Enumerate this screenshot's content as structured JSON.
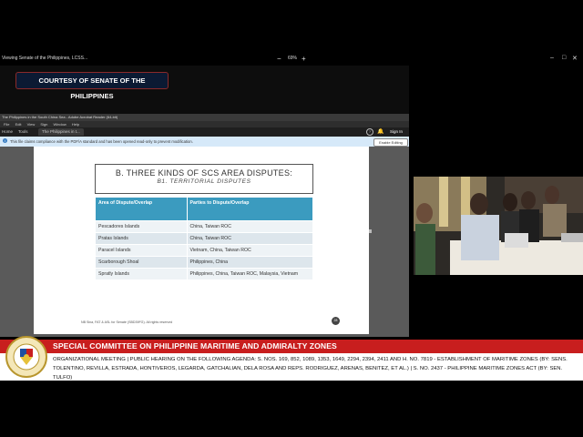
{
  "share_bar": {
    "title": "Viewing Senate of the Philippines, LCSS...",
    "zoom_minus": "−",
    "zoom": "69%",
    "zoom_plus": "+",
    "minimize": "–",
    "maximize": "□",
    "close": "✕"
  },
  "banner": {
    "courtesy": "COURTESY OF SENATE OF THE PHILIPPINES"
  },
  "acrobat": {
    "title": "The Philippines in the South China Sea - Adobe Acrobat Reader (64-bit)",
    "menu": [
      "File",
      "Edit",
      "View",
      "Sign",
      "Window",
      "Help"
    ],
    "tabs": {
      "home": "Home",
      "tools": "Tools",
      "document": "The Philippines in t... ✕"
    },
    "sign_in": "Sign In",
    "help_glyph": "?",
    "bell_glyph": "🔔",
    "info_text": "This file claims compliance with the PDF/A standard and has been opened read-only to prevent modification.",
    "enable_editing": "Enable Editing"
  },
  "slide": {
    "heading": "B. THREE KINDS OF SCS AREA DISPUTES:",
    "subheading": "B1. TERRITORIAL DISPUTES",
    "table": {
      "headers": [
        "Area of Dispute/Overlap",
        "Parties to Dispute/Overlap"
      ],
      "rows": [
        [
          "Pescadores Islands",
          "China, Taiwan ROC"
        ],
        [
          "Pratas Islands",
          "China, Taiwan ROC"
        ],
        [
          "Paracel Islands",
          "Vietnam, China, Taiwan ROC"
        ],
        [
          "Scarborough Shoal",
          "Philippines, China"
        ],
        [
          "Spratly Islands",
          "Philippines, China, Taiwan ROC, Malaysia, Vietnam"
        ]
      ]
    },
    "footer": "NB Sina, FAT & ASL for Senate (SBD39FG). All rights reserved",
    "page_number": "28"
  },
  "lower_third": {
    "committee": "SPECIAL COMMITTEE ON PHILIPPINE MARITIME AND ADMIRALTY ZONES",
    "agenda": "ORGANIZATIONAL MEETING   |   PUBLIC HEARING ON THE FOLLOWING AGENDA:  S. NOS. 169, 852, 1089, 1353, 1649, 2294, 2394, 2411 AND H. NO. 7819 - ESTABLISHMENT OF MARITIME ZONES (BY: SENS. TOLENTINO, REVILLA, ESTRADA, HONTIVEROS, LEGARDA, GATCHALIAN, DELA ROSA AND REPS. RODRIGUEZ, ARENAS, BENITEZ, ET AL.)   |   S. NO. 2437 - PHILIPPINE MARITIME ZONES ACT (BY: SEN. TULFO)"
  },
  "colors": {
    "title_red": "#c81e1e",
    "table_header_teal": "#3b9bbf",
    "banner_navy": "#0b1a33"
  }
}
